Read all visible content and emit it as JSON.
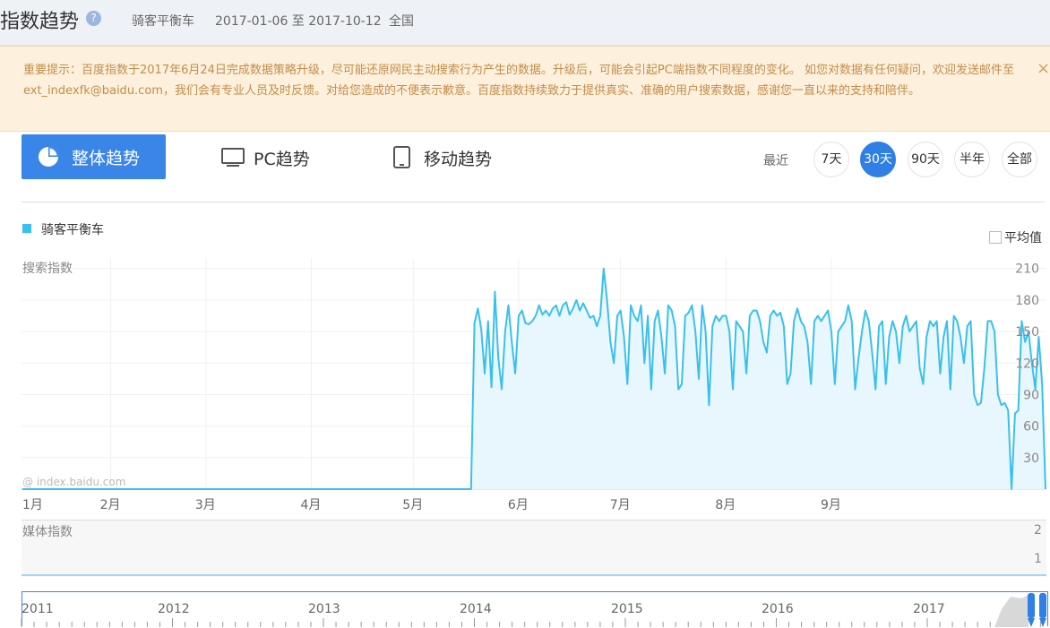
{
  "header": {
    "title": "指数趋势",
    "help": "?",
    "keyword": "骑客平衡车",
    "date_range": "2017-01-06 至 2017-10-12",
    "region": "全国"
  },
  "notice": {
    "text": "重要提示：百度指数于2017年6月24日完成数据策略升级，尽可能还原网民主动搜索行为产生的数据。升级后，可能会引起PC端指数不同程度的变化。 如您对数据有任何疑问，欢迎发送邮件至ext_indexfk@baidu.com，我们会有专业人员及时反馈。对给您造成的不便表示歉意。百度指数持续致力于提供真实、准确的用户搜索数据，感谢您一直以来的支持和陪伴。",
    "close": "×"
  },
  "tabs": {
    "overall": "整体趋势",
    "pc": "PC趋势",
    "mobile": "移动趋势"
  },
  "range": {
    "label": "最近",
    "options": [
      "7天",
      "30天",
      "90天",
      "半年",
      "全部"
    ],
    "selected": "30天"
  },
  "legend": {
    "series": "骑客平衡车",
    "average": "平均值"
  },
  "colors": {
    "accent": "#3a85e8",
    "series": "#39c0ee"
  },
  "chart_data": {
    "type": "area",
    "ylabel": "搜索指数",
    "watermark": "@ index.baidu.com",
    "y_ticks": [
      "210",
      "180",
      "150",
      "120",
      "90",
      "60",
      "30"
    ],
    "ylim": [
      0,
      220
    ],
    "x_labels": [
      "1月",
      "2月",
      "3月",
      "4月",
      "5月",
      "6月",
      "7月",
      "8月",
      "9月"
    ],
    "grid": true,
    "series": [
      {
        "name": "骑客平衡车",
        "start": "2017-01-06",
        "values": [
          0,
          0,
          0,
          0,
          0,
          0,
          0,
          0,
          0,
          0,
          0,
          0,
          0,
          0,
          0,
          0,
          0,
          0,
          0,
          0,
          0,
          0,
          0,
          0,
          0,
          0,
          0,
          0,
          0,
          0,
          0,
          0,
          0,
          0,
          0,
          0,
          0,
          0,
          0,
          0,
          0,
          0,
          0,
          0,
          0,
          0,
          0,
          0,
          0,
          0,
          0,
          0,
          0,
          0,
          0,
          0,
          0,
          0,
          0,
          0,
          0,
          0,
          0,
          0,
          0,
          0,
          0,
          0,
          0,
          0,
          0,
          0,
          0,
          0,
          0,
          0,
          0,
          0,
          0,
          0,
          0,
          0,
          0,
          0,
          0,
          0,
          0,
          0,
          0,
          0,
          0,
          0,
          0,
          0,
          0,
          0,
          0,
          0,
          0,
          0,
          0,
          0,
          0,
          0,
          0,
          0,
          0,
          0,
          0,
          0,
          0,
          0,
          0,
          0,
          0,
          0,
          0,
          0,
          0,
          0,
          0,
          0,
          0,
          0,
          0,
          0,
          0,
          0,
          0,
          0,
          0,
          0,
          0,
          158,
          172,
          152,
          110,
          160,
          97,
          188,
          125,
          95,
          150,
          175,
          140,
          110,
          165,
          170,
          158,
          157,
          160,
          165,
          175,
          166,
          170,
          165,
          172,
          175,
          165,
          175,
          178,
          166,
          172,
          180,
          170,
          177,
          170,
          163,
          165,
          155,
          165,
          210,
          180,
          140,
          120,
          165,
          170,
          145,
          100,
          175,
          165,
          160,
          175,
          120,
          165,
          95,
          160,
          170,
          145,
          110,
          175,
          170,
          155,
          95,
          100,
          165,
          168,
          175,
          150,
          105,
          175,
          150,
          80,
          155,
          165,
          160,
          165,
          165,
          150,
          95,
          160,
          155,
          150,
          110,
          165,
          170,
          170,
          160,
          140,
          130,
          165,
          170,
          165,
          168,
          155,
          100,
          110,
          160,
          172,
          160,
          155,
          140,
          100,
          160,
          165,
          160,
          165,
          170,
          150,
          100,
          150,
          155,
          160,
          175,
          160,
          95,
          125,
          150,
          170,
          160,
          130,
          95,
          155,
          160,
          100,
          145,
          160,
          150,
          120,
          155,
          165,
          150,
          155,
          160,
          115,
          100,
          145,
          160,
          155,
          160,
          110,
          145,
          160,
          95,
          165,
          160,
          145,
          120,
          155,
          160,
          90,
          80,
          82,
          115,
          160,
          160,
          150,
          90,
          80,
          82,
          75,
          0,
          72,
          75,
          160,
          140,
          150,
          120,
          95,
          145,
          100,
          0
        ]
      }
    ]
  },
  "media": {
    "label": "媒体指数",
    "tick_high": "2",
    "tick_low": "1"
  },
  "timeline": {
    "years": [
      "2011",
      "2012",
      "2013",
      "2014",
      "2015",
      "2016",
      "2017"
    ]
  }
}
